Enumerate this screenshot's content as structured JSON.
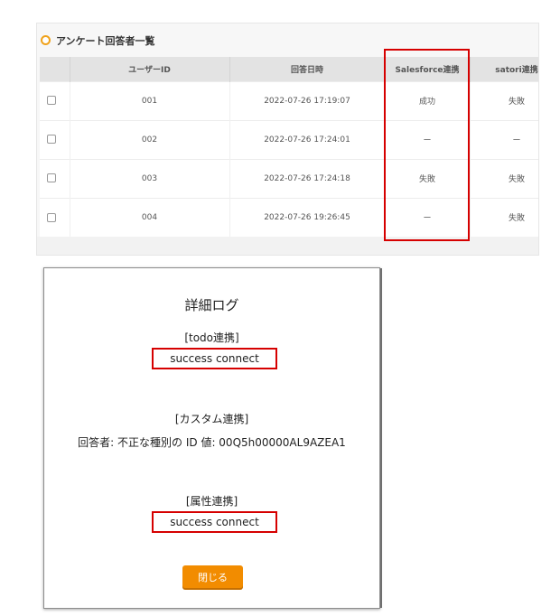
{
  "survey": {
    "title": "アンケート回答者一覧",
    "columns": [
      "",
      "ユーザーID",
      "回答日時",
      "Salesforce連携",
      "satori連携"
    ],
    "rows": [
      {
        "id": "001",
        "date": "2022-07-26 17:19:07",
        "salesforce": "成功",
        "satori": "失敗"
      },
      {
        "id": "002",
        "date": "2022-07-26 17:24:01",
        "salesforce": "ー",
        "satori": "ー"
      },
      {
        "id": "003",
        "date": "2022-07-26 17:24:18",
        "salesforce": "失敗",
        "satori": "失敗"
      },
      {
        "id": "004",
        "date": "2022-07-26 19:26:45",
        "salesforce": "ー",
        "satori": "失敗"
      }
    ]
  },
  "modal": {
    "title": "詳細ログ",
    "todo": {
      "label": "[todo連携]",
      "status": "success connect"
    },
    "custom": {
      "label": "[カスタム連携]",
      "message": "回答者: 不正な種別の ID 値: 00Q5h00000AL9AZEA1"
    },
    "attribute": {
      "label": "[属性連携]",
      "status": "success connect"
    },
    "close_label": "閉じる"
  },
  "colors": {
    "accent": "#f28c00",
    "highlight": "#d60000",
    "header_bg": "#e3e3e3"
  }
}
